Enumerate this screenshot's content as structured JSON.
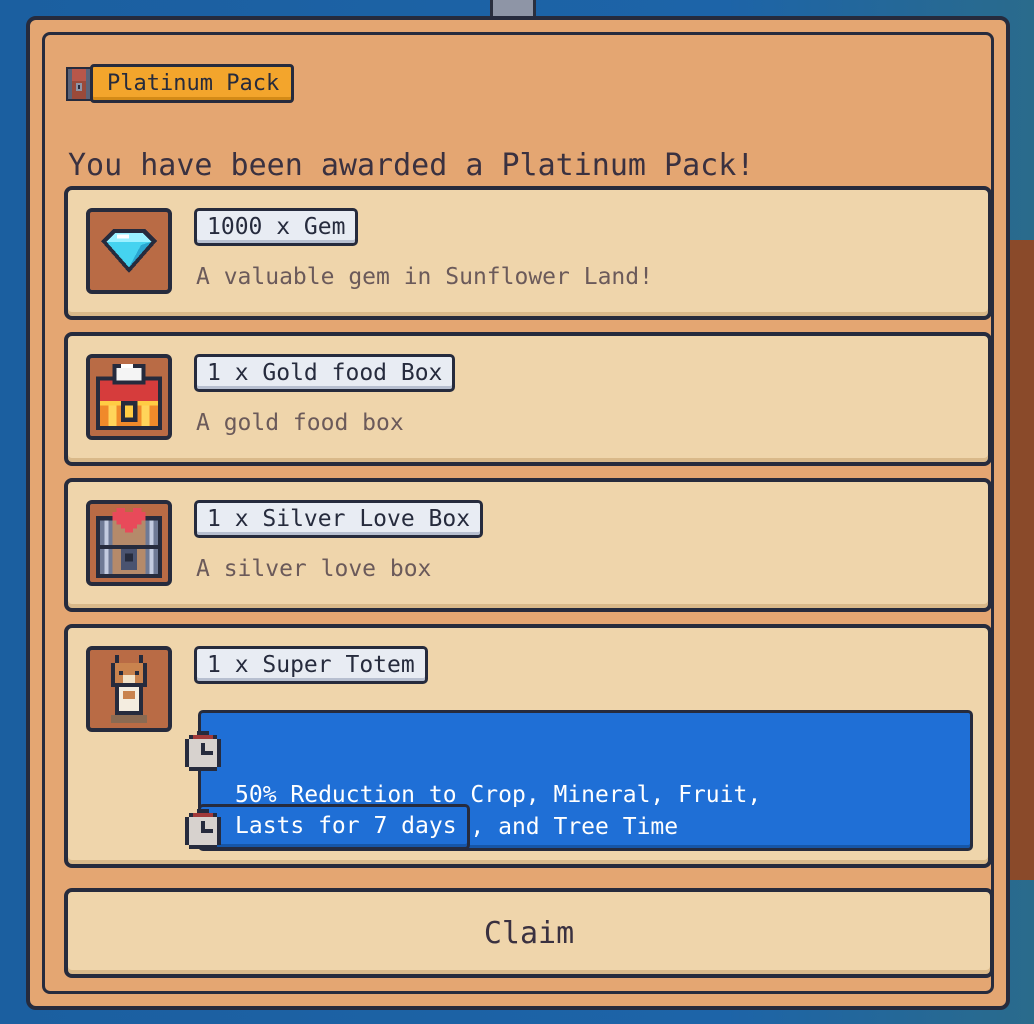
{
  "header": {
    "badge_label": "Platinum Pack",
    "icon": "chest-icon"
  },
  "headline": "You have been awarded a Platinum Pack!",
  "items": [
    {
      "title": "1000 x Gem",
      "description": "A valuable gem in Sunflower Land!",
      "icon": "gem-icon"
    },
    {
      "title": "1 x Gold food Box",
      "description": "A gold food box",
      "icon": "gold-food-box-icon"
    },
    {
      "title": "1 x Silver Love Box",
      "description": "A silver love box",
      "icon": "silver-love-box-icon"
    },
    {
      "title": "1 x Super Totem",
      "icon": "super-totem-icon",
      "boosts": [
        {
          "text": "50% Reduction to Crop, Mineral, Fruit,\nCooking, Crafting, and Tree Time",
          "icon": "stopwatch-icon"
        },
        {
          "text": "Lasts for 7 days",
          "icon": "stopwatch-icon"
        }
      ]
    }
  ],
  "claim_label": "Claim",
  "colors": {
    "panel": "#e4a672",
    "card": "#efd5ab",
    "boost": "#1f6fd6",
    "badge": "#f3a52c",
    "outline": "#262b3d"
  }
}
